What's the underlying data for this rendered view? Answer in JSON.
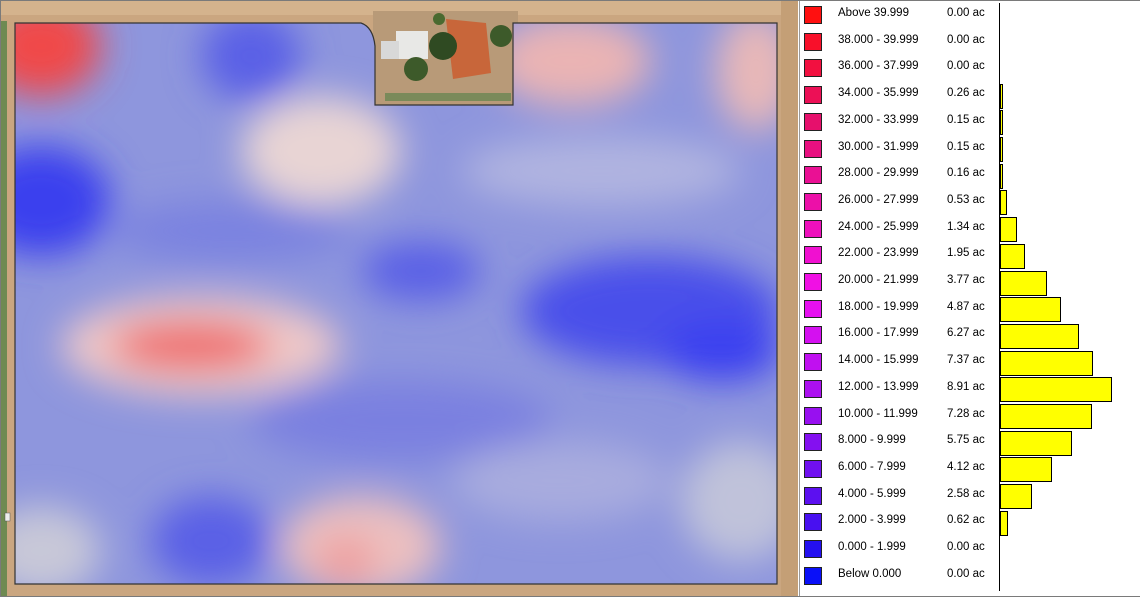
{
  "map": {
    "background_color": "#c9a57e",
    "field_base_color": "#8e96dd",
    "low_color": "#3a3ff0",
    "high_color": "#f04a4a"
  },
  "legend": {
    "items": [
      {
        "range": "Above 39.999",
        "area": "0.00 ac",
        "color": "#ff1010",
        "acres": 0.0
      },
      {
        "range": "38.000 - 39.999",
        "area": "0.00 ac",
        "color": "#f8102a",
        "acres": 0.0
      },
      {
        "range": "36.000 - 37.999",
        "area": "0.00 ac",
        "color": "#f21040",
        "acres": 0.0
      },
      {
        "range": "34.000 - 35.999",
        "area": "0.26 ac",
        "color": "#ec1056",
        "acres": 0.26
      },
      {
        "range": "32.000 - 33.999",
        "area": "0.15 ac",
        "color": "#e6106c",
        "acres": 0.15
      },
      {
        "range": "30.000 - 31.999",
        "area": "0.15 ac",
        "color": "#e81080",
        "acres": 0.15
      },
      {
        "range": "28.000 - 29.999",
        "area": "0.16 ac",
        "color": "#ea1094",
        "acres": 0.16
      },
      {
        "range": "26.000 - 27.999",
        "area": "0.53 ac",
        "color": "#ec10a8",
        "acres": 0.53
      },
      {
        "range": "24.000 - 25.999",
        "area": "1.34 ac",
        "color": "#ee10bc",
        "acres": 1.34
      },
      {
        "range": "22.000 - 23.999",
        "area": "1.95 ac",
        "color": "#f010d0",
        "acres": 1.95
      },
      {
        "range": "20.000 - 21.999",
        "area": "3.77 ac",
        "color": "#f010e4",
        "acres": 3.77
      },
      {
        "range": "18.000 - 19.999",
        "area": "4.87 ac",
        "color": "#e610f0",
        "acres": 4.87
      },
      {
        "range": "16.000 - 17.999",
        "area": "6.27 ac",
        "color": "#d410f0",
        "acres": 6.27
      },
      {
        "range": "14.000 - 15.999",
        "area": "7.37 ac",
        "color": "#c010f0",
        "acres": 7.37
      },
      {
        "range": "12.000 - 13.999",
        "area": "8.91 ac",
        "color": "#ac10f0",
        "acres": 8.91
      },
      {
        "range": "10.000 - 11.999",
        "area": "7.28 ac",
        "color": "#9810f0",
        "acres": 7.28
      },
      {
        "range": "8.000 - 9.999",
        "area": "5.75 ac",
        "color": "#8410f0",
        "acres": 5.75
      },
      {
        "range": "6.000 - 7.999",
        "area": "4.12 ac",
        "color": "#7010f0",
        "acres": 4.12
      },
      {
        "range": "4.000 - 5.999",
        "area": "2.58 ac",
        "color": "#5c10f0",
        "acres": 2.58
      },
      {
        "range": "2.000 - 3.999",
        "area": "0.62 ac",
        "color": "#4810f0",
        "acres": 0.62
      },
      {
        "range": "0.000 - 1.999",
        "area": "0.00 ac",
        "color": "#2410f0",
        "acres": 0.0
      },
      {
        "range": "Below 0.000",
        "area": "0.00 ac",
        "color": "#0a10f8",
        "acres": 0.0
      }
    ],
    "histogram_color": "#ffff00"
  }
}
